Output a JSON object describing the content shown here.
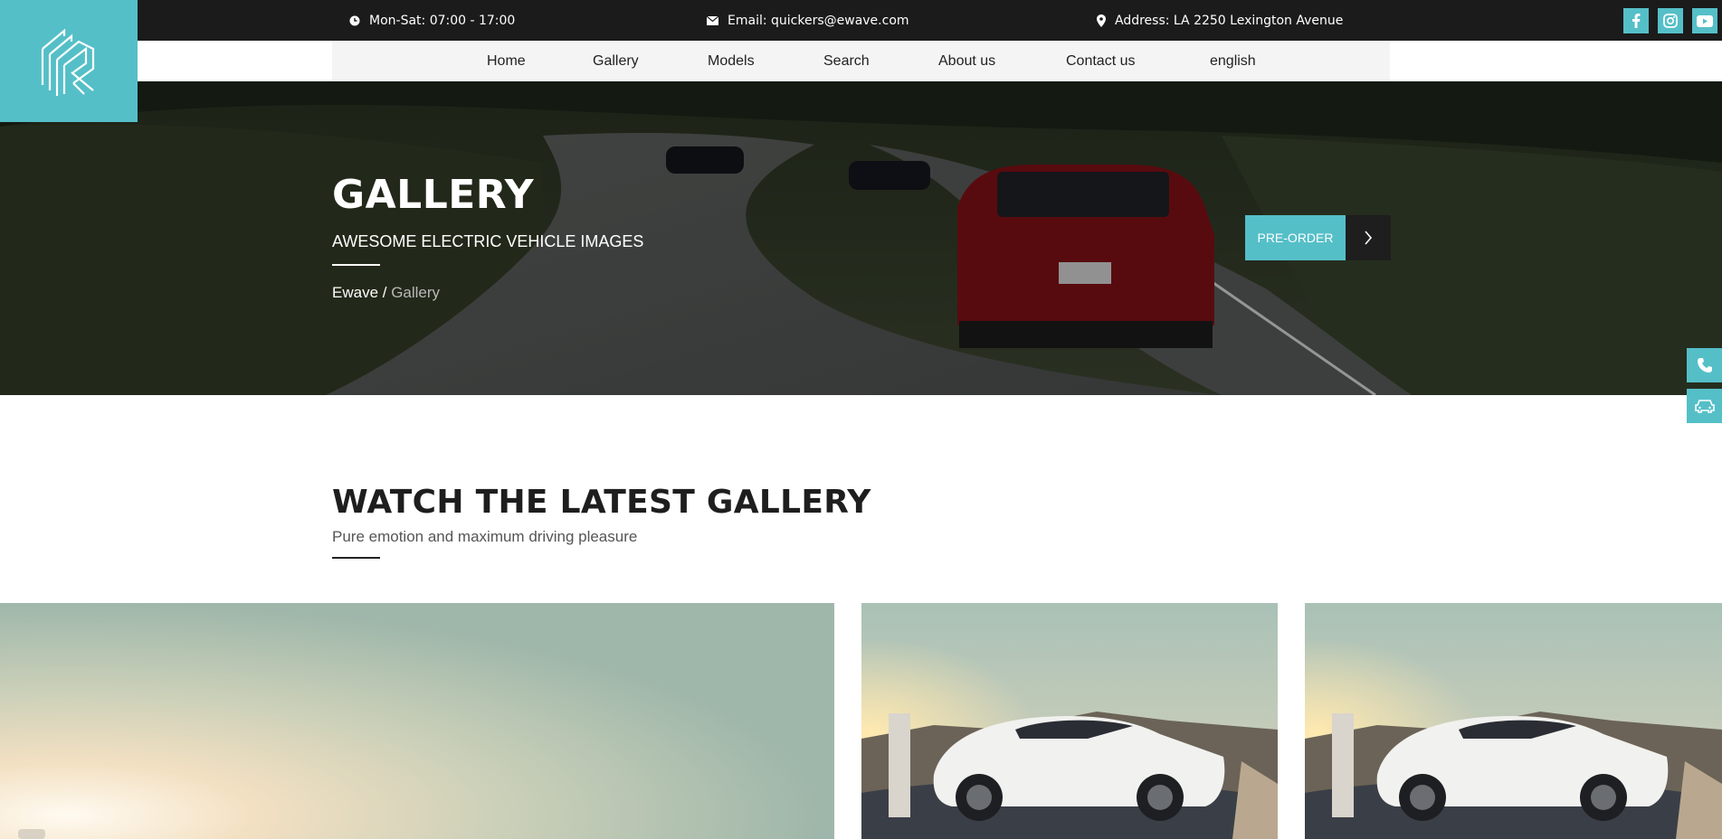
{
  "topbar": {
    "hours": "Mon-Sat: 07:00 - 17:00",
    "email": "Email: quickers@ewave.com",
    "address": "Address: LA 2250 Lexington Avenue",
    "social": [
      "facebook-icon",
      "instagram-icon",
      "youtube-icon"
    ]
  },
  "nav": {
    "items": [
      {
        "label": "Home"
      },
      {
        "label": "Gallery"
      },
      {
        "label": "Models"
      },
      {
        "label": "Search"
      },
      {
        "label": "About us"
      },
      {
        "label": "Contact us"
      },
      {
        "label": "english"
      }
    ]
  },
  "hero": {
    "title": "GALLERY",
    "subtitle": "AWESOME ELECTRIC VEHICLE IMAGES",
    "breadcrumb": {
      "home": "Ewave",
      "separator": " / ",
      "current": "Gallery"
    },
    "cta": "PRE-ORDER"
  },
  "section": {
    "title": "WATCH THE LATEST GALLERY",
    "subtitle": "Pure emotion and maximum driving pleasure"
  },
  "colors": {
    "accent": "#55bfc8",
    "dark": "#1b1b1b"
  }
}
